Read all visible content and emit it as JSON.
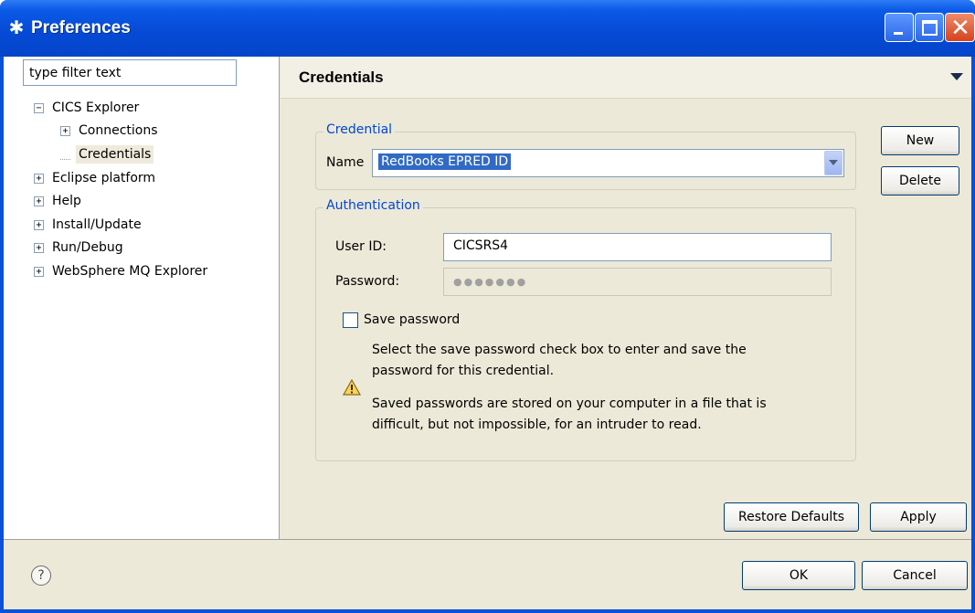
{
  "window": {
    "title": "Preferences",
    "icon": "gear-icon",
    "controls": {
      "minimize": "minimize-icon",
      "maximize": "maximize-icon",
      "close": "close-icon",
      "close_glyph": "✕"
    }
  },
  "sidebar": {
    "filter_placeholder": "type filter text",
    "filter_value": "type filter text",
    "tree": [
      {
        "label": "CICS Explorer",
        "expander": "−",
        "selected": false
      },
      {
        "label": "Connections",
        "expander": "+",
        "selected": false
      },
      {
        "label": "Credentials",
        "expander": "",
        "selected": true
      },
      {
        "label": "Eclipse platform",
        "expander": "+",
        "selected": false
      },
      {
        "label": "Help",
        "expander": "+",
        "selected": false
      },
      {
        "label": "Install/Update",
        "expander": "+",
        "selected": false
      },
      {
        "label": "Run/Debug",
        "expander": "+",
        "selected": false
      },
      {
        "label": "WebSphere MQ Explorer",
        "expander": "+",
        "selected": false
      }
    ]
  },
  "main": {
    "title": "Credentials",
    "credential_group": {
      "legend": "Credential",
      "name_label": "Name",
      "name_value": "RedBooks EPRED ID"
    },
    "buttons": {
      "new": "New",
      "delete": "Delete"
    },
    "authentication_group": {
      "legend": "Authentication",
      "user_id_label": "User ID:",
      "user_id_value": "CICSRS4",
      "password_label": "Password:",
      "password_value": "●●●●●●●",
      "save_password_label": "Save password",
      "save_password_checked": false,
      "info_line1": "Select the save password check box to enter and save the",
      "info_line2": "password for this credential.",
      "warning_line1": "Saved passwords are stored on your computer in a file that is",
      "warning_line2": "difficult, but not impossible, for an intruder to read."
    },
    "restore_defaults": "Restore Defaults",
    "apply": "Apply"
  },
  "footer": {
    "help_glyph": "?",
    "ok": "OK",
    "cancel": "Cancel"
  },
  "colors": {
    "titlebar": "#0549D4",
    "dialog_bg": "#ECE9D8",
    "group_legend": "#0046D5",
    "selection": "#316AC5"
  }
}
